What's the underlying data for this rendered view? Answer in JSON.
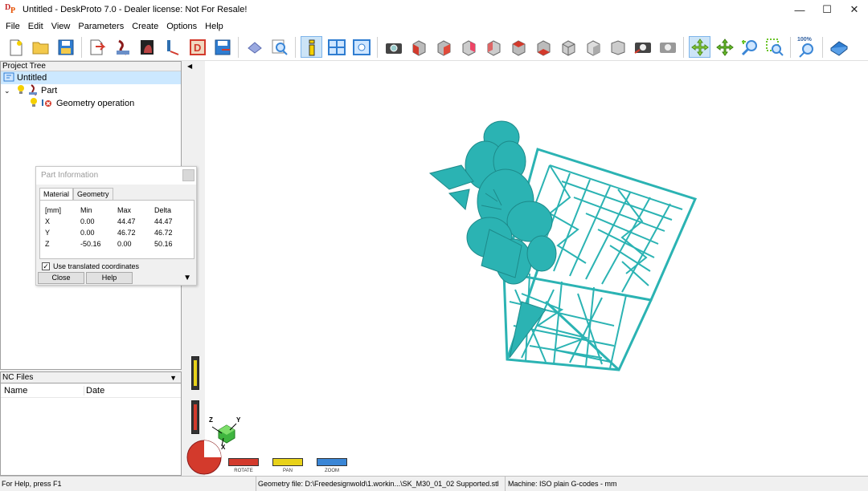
{
  "window": {
    "title": "Untitled - DeskProto 7.0 - Dealer license: Not For Resale!",
    "icon_text": [
      "D",
      "P"
    ]
  },
  "menu": [
    "File",
    "Edit",
    "View",
    "Parameters",
    "Create",
    "Options",
    "Help"
  ],
  "toolbar": {
    "zoom_label": "100%"
  },
  "project_tree": {
    "header": "Project Tree",
    "items": [
      {
        "label": "Untitled",
        "selected": true
      },
      {
        "label": "Part",
        "expanded": true
      },
      {
        "label": "Geometry operation"
      }
    ]
  },
  "part_info": {
    "title": "Part Information",
    "tabs": [
      "Material",
      "Geometry"
    ],
    "active_tab": "Material",
    "headers": [
      "[mm]",
      "Min",
      "Max",
      "Delta"
    ],
    "rows": [
      {
        "axis": "X",
        "min": "0.00",
        "max": "44.47",
        "delta": "44.47"
      },
      {
        "axis": "Y",
        "min": "0.00",
        "max": "46.72",
        "delta": "46.72"
      },
      {
        "axis": "Z",
        "min": "-50.16",
        "max": "0.00",
        "delta": "50.16"
      }
    ],
    "checkbox_label": "Use translated coordinates",
    "checkbox_checked": true,
    "close_label": "Close",
    "help_label": "Help"
  },
  "nc_files": {
    "header": "NC Files",
    "columns": [
      "Name",
      "Date"
    ]
  },
  "view_controls": {
    "rotate_label": "ROTATE",
    "pan_label": "PAN",
    "zoom_label": "ZOOM",
    "axes": {
      "x": "X",
      "y": "Y",
      "z": "Z"
    }
  },
  "status": {
    "help": "For Help, press F1",
    "geometry_file": "Geometry file: D:\\Freedesignwold\\1.workin...\\SK_M30_01_02 Supported.stl",
    "machine": "Machine: ISO plain G-codes - mm"
  },
  "colors": {
    "model": "#2bb3b3",
    "rotate": "#d33a2c",
    "pan": "#e8d21a",
    "zoom": "#3a86d6"
  }
}
